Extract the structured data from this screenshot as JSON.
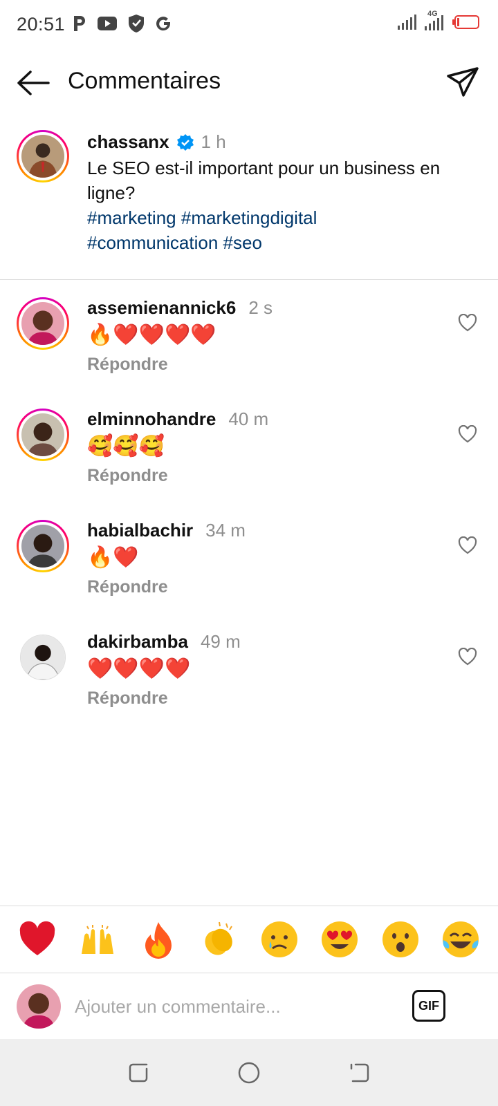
{
  "status_bar": {
    "time": "20:51",
    "network": "4G",
    "left_icons": [
      "parking-icon",
      "youtube-icon",
      "shield-icon",
      "google-icon"
    ],
    "battery_color": "#e53935"
  },
  "header": {
    "title": "Commentaires",
    "back_icon": "arrow-left-icon",
    "send_icon": "paper-plane-icon"
  },
  "caption": {
    "username": "chassanx",
    "verified": true,
    "time": "1 h",
    "text": "Le SEO est-il important pour un business en ligne?",
    "hashtags": [
      "#marketing",
      "#marketingdigital",
      "#communication",
      "#seo"
    ],
    "hashtag_color": "#00376b"
  },
  "comments": [
    {
      "username": "assemienannick6",
      "time": "2 s",
      "text": "🔥❤️❤️❤️❤️",
      "reply_label": "Répondre",
      "story_ring": true
    },
    {
      "username": "elminnohandre",
      "time": "40 m",
      "text": "🥰🥰🥰",
      "reply_label": "Répondre",
      "story_ring": true
    },
    {
      "username": "habialbachir",
      "time": "34 m",
      "text": "🔥❤️",
      "reply_label": "Répondre",
      "story_ring": true
    },
    {
      "username": "dakirbamba",
      "time": "49 m",
      "text": "❤️❤️❤️❤️",
      "reply_label": "Répondre",
      "story_ring": false
    }
  ],
  "reactions": [
    "❤️",
    "🙌",
    "🔥",
    "👏",
    "😢",
    "😍",
    "😮",
    "😂"
  ],
  "composer": {
    "placeholder": "Ajouter un commentaire...",
    "gif_label": "GIF"
  },
  "nav": [
    "recent-apps-icon",
    "home-icon",
    "back-nav-icon"
  ]
}
